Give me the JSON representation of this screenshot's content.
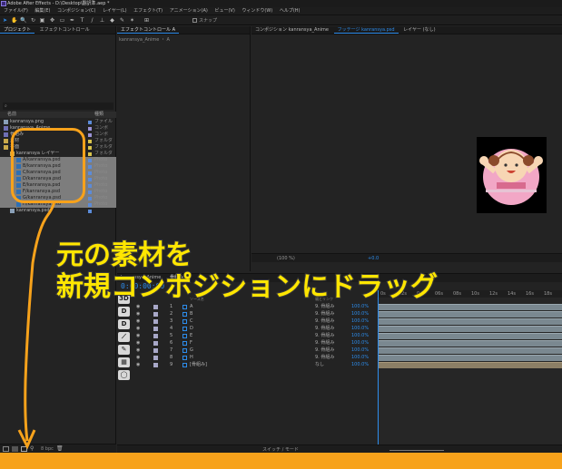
{
  "titlebar": {
    "title": "Adobe After Effects - D:\\Desktop\\翻訳準.aep *"
  },
  "menu": [
    "ファイル(F)",
    "編集(E)",
    "コンポジション(C)",
    "レイヤー(L)",
    "エフェクト(T)",
    "アニメーション(A)",
    "ビュー(V)",
    "ウィンドウ(W)",
    "ヘルプ(H)"
  ],
  "toolbar": {
    "snap_label": "スナップ"
  },
  "project_panel": {
    "tabs": [
      "プロジェクト",
      "エフェクトコントロール"
    ],
    "search_placeholder": "",
    "col_name": "名前",
    "col_type": "種類",
    "items": [
      {
        "name": "kanransya.png",
        "type": "ファイル",
        "label": "#5b8bd9",
        "indent": 0,
        "kind": "file",
        "hl": false
      },
      {
        "name": "kanransya_Anime",
        "type": "コンポ",
        "label": "#9b93d8",
        "indent": 0,
        "kind": "comp",
        "hl": false
      },
      {
        "name": "骨組み",
        "type": "コンポ",
        "label": "#9b93d8",
        "indent": 0,
        "kind": "comp",
        "hl": false
      },
      {
        "name": "素材",
        "type": "フォルダ",
        "label": "#d9c44b",
        "indent": 0,
        "kind": "folder",
        "hl": false
      },
      {
        "name": "平面",
        "type": "フォルダ",
        "label": "#d9c44b",
        "indent": 0,
        "kind": "folder",
        "hl": false
      },
      {
        "name": "kanransya レイヤー",
        "type": "フォルダ",
        "label": "#d9c44b",
        "indent": 1,
        "kind": "folder",
        "hl": false
      },
      {
        "name": "A/kanransya.psd",
        "type": "Photo",
        "label": "#5b8bd9",
        "indent": 2,
        "kind": "psd",
        "hl": true
      },
      {
        "name": "B/kanransya.psd",
        "type": "Photo",
        "label": "#5b8bd9",
        "indent": 2,
        "kind": "psd",
        "hl": true
      },
      {
        "name": "C/kanransya.psd",
        "type": "Photo",
        "label": "#5b8bd9",
        "indent": 2,
        "kind": "psd",
        "hl": true
      },
      {
        "name": "D/kanransya.psd",
        "type": "Photo",
        "label": "#5b8bd9",
        "indent": 2,
        "kind": "psd",
        "hl": true
      },
      {
        "name": "E/kanransya.psd",
        "type": "Photo",
        "label": "#5b8bd9",
        "indent": 2,
        "kind": "psd",
        "hl": true
      },
      {
        "name": "F/kanransya.psd",
        "type": "Photo",
        "label": "#5b8bd9",
        "indent": 2,
        "kind": "psd",
        "hl": true
      },
      {
        "name": "G/kanransya.psd",
        "type": "Photo",
        "label": "#5b8bd9",
        "indent": 2,
        "kind": "psd",
        "hl": true
      },
      {
        "name": "H/kanransya.psd",
        "type": "Photo",
        "label": "#5b8bd9",
        "indent": 2,
        "kind": "psd",
        "hl": true
      },
      {
        "name": "kanransya.psd",
        "type": "",
        "label": "#5b8bd9",
        "indent": 1,
        "kind": "file",
        "hl": false
      }
    ],
    "bottom_bpc": "8 bpc"
  },
  "effect_panel": {
    "tab": "エフェクトコントロール A",
    "subtitle": "kanransya_Anime ・ A"
  },
  "comp_panel": {
    "tabs": [
      "コンポジション kanransya_Anime",
      "フッテージ kanransya.psd",
      "レイヤー (なし)"
    ],
    "zoom": "(100 %)",
    "offset": "+0.0"
  },
  "timeline": {
    "tabs": [
      "kanransya_Anime",
      "骨組み"
    ],
    "timecode": "0:00:00:00",
    "col_source": "ソース名",
    "col_parent": "親とリンク",
    "ruler": [
      "0s",
      "02s",
      "04s",
      "06s",
      "08s",
      "10s",
      "12s",
      "14s",
      "16s",
      "18s",
      "20s"
    ],
    "layers": [
      {
        "num": "1",
        "name": "A",
        "parent": "9. 骨組み",
        "pct": "100.0%"
      },
      {
        "num": "2",
        "name": "B",
        "parent": "9. 骨組み",
        "pct": "100.0%"
      },
      {
        "num": "3",
        "name": "C",
        "parent": "9. 骨組み",
        "pct": "100.0%"
      },
      {
        "num": "4",
        "name": "D",
        "parent": "9. 骨組み",
        "pct": "100.0%"
      },
      {
        "num": "5",
        "name": "E",
        "parent": "9. 骨組み",
        "pct": "100.0%"
      },
      {
        "num": "6",
        "name": "F",
        "parent": "9. 骨組み",
        "pct": "100.0%"
      },
      {
        "num": "7",
        "name": "G",
        "parent": "9. 骨組み",
        "pct": "100.0%"
      },
      {
        "num": "8",
        "name": "H",
        "parent": "9. 骨組み",
        "pct": "100.0%"
      },
      {
        "num": "9",
        "name": "[骨組み]",
        "parent": "なし",
        "pct": "100.0%"
      }
    ],
    "left_icons": [
      "3D",
      "D",
      "D"
    ],
    "footer_label": "スイッチ / モード"
  },
  "callout": {
    "line1": "元の素材を",
    "line2": "新規コンポジションにドラッグ"
  },
  "colors": {
    "accent": "#2d8ceb",
    "callout": "#ffe600",
    "arrow": "#f7a21b"
  }
}
